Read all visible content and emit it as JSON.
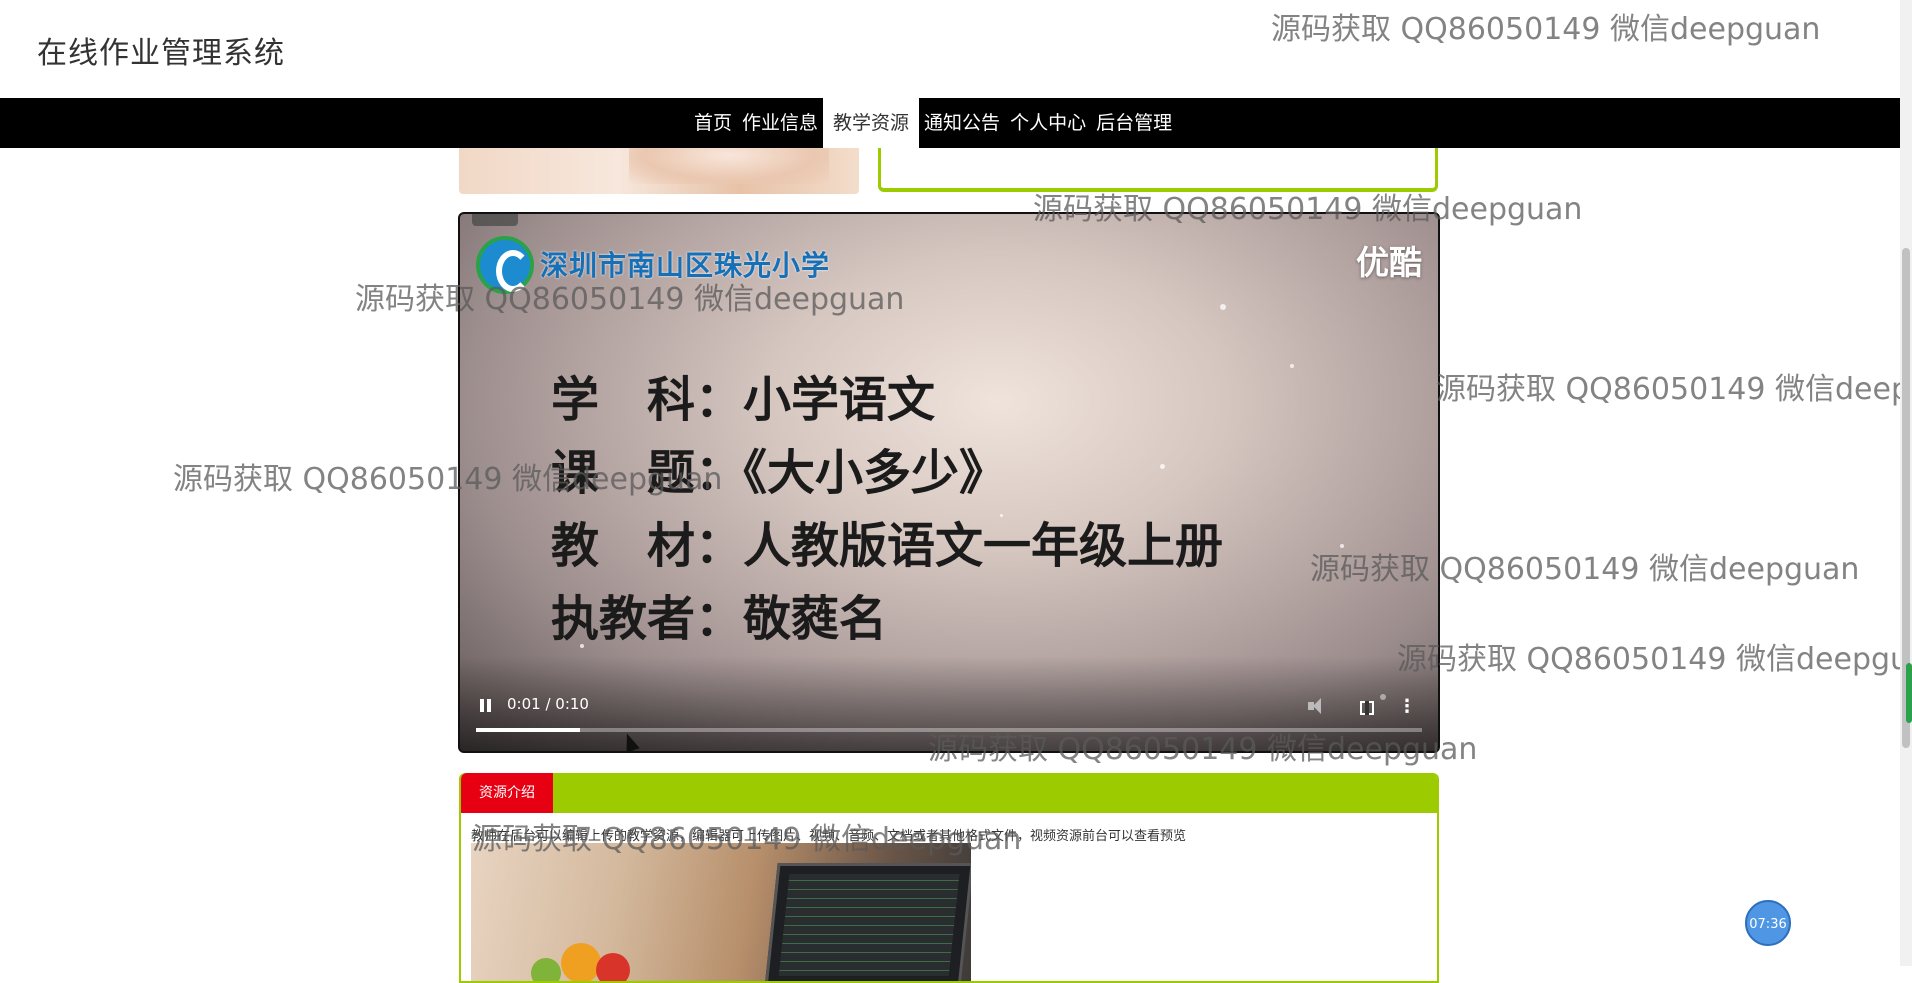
{
  "site": {
    "title": "在线作业管理系统"
  },
  "nav": {
    "items": [
      {
        "label": "首页"
      },
      {
        "label": "作业信息"
      },
      {
        "label": "教学资源",
        "active": true
      },
      {
        "label": "通知公告"
      },
      {
        "label": "个人中心"
      },
      {
        "label": "后台管理"
      }
    ]
  },
  "video": {
    "school_name": "深圳市南山区珠光小学",
    "brand": "优酷",
    "lines": [
      "学　科：小学语文",
      "课　题：《大小多少》",
      "教　材：人教版语文一年级上册",
      "执教者：敬蕤名"
    ],
    "time": "0:01 / 0:10",
    "progress": 0.11,
    "state": "playing"
  },
  "intro": {
    "tab_label": "资源介绍",
    "text": "教师在后台可以编辑上传的教学资源，编辑器可上传图片、视频、音频、文档或者其他格式文件，视频资源前台可以查看预览"
  },
  "clock": "07:36",
  "watermark": "源码获取 QQ86050149 微信deepguan",
  "colors": {
    "nav_bg": "#000000",
    "accent_green": "#9ccc00",
    "tab_red": "#e60012"
  }
}
